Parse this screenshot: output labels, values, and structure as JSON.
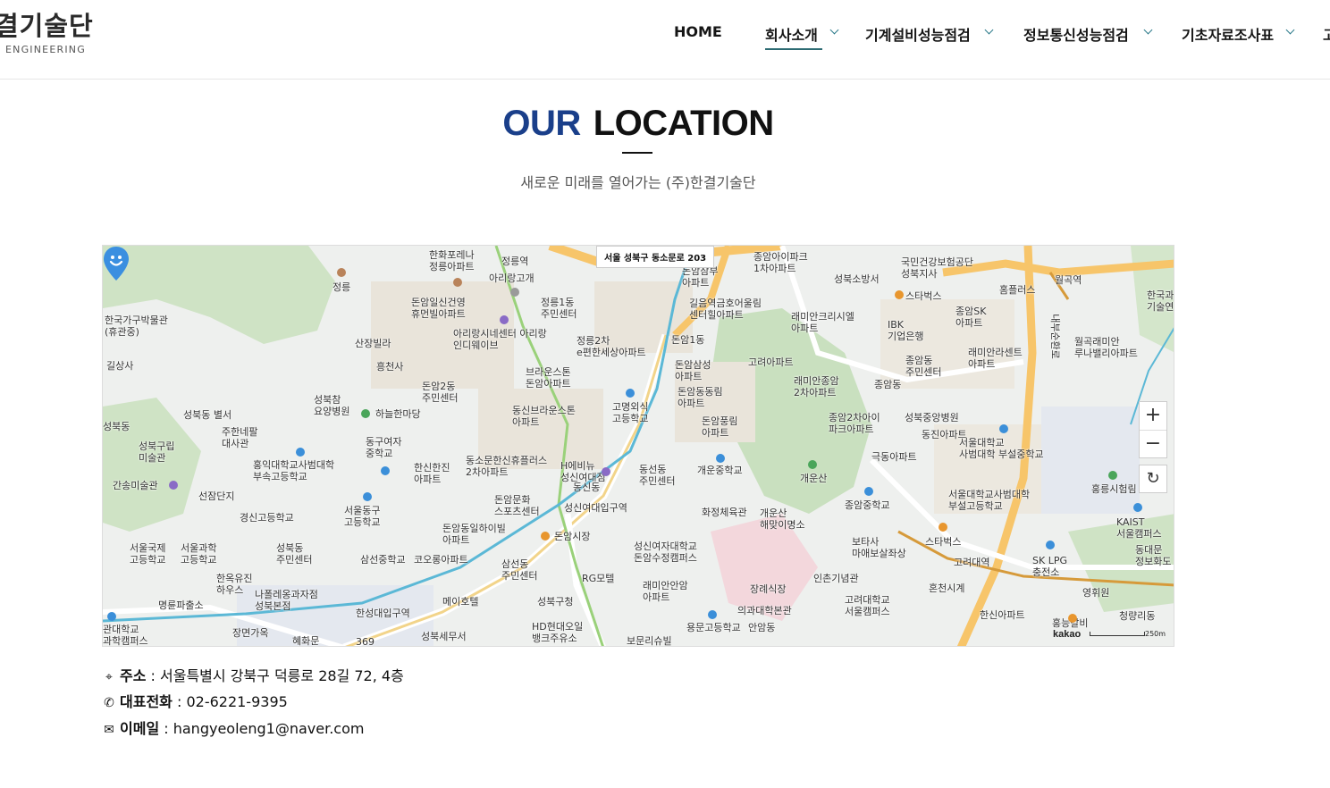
{
  "header": {
    "logo_text": "결기술단",
    "logo_sub": "ENGINEERING",
    "nav": [
      {
        "label": "HOME",
        "has_dropdown": false
      },
      {
        "label": "회사소개",
        "has_dropdown": true,
        "active": true
      },
      {
        "label": "기계설비성능점검",
        "has_dropdown": true
      },
      {
        "label": "정보통신성능점검",
        "has_dropdown": true
      },
      {
        "label": "기초자료조사표",
        "has_dropdown": true
      },
      {
        "label": "고",
        "has_dropdown": false
      }
    ]
  },
  "section": {
    "title_accent": "OUR",
    "title_main": "LOCATION",
    "subtitle": "새로운 미래를 열어가는 (주)한결기술단"
  },
  "map": {
    "tooltip": "서울 성북구 동소문로 203",
    "zoom_in": "+",
    "zoom_out": "−",
    "reset": "↻",
    "brand": "kakao",
    "scale_label": "250m",
    "labels": {
      "l1": "한화포레나\n정릉아파트",
      "l2": "정릉역",
      "l3": "아리랑고개",
      "l4": "정릉",
      "l5": "돈암일신건영\n휴먼빌아파트",
      "l6": "정릉1동\n주민센터",
      "l7": "한국가구박물관\n(휴관중)",
      "l8": "아리랑시네센터 아리랑\n인디웨이브",
      "l9": "산장빌라",
      "l10": "정릉2차\ne편한세상아파트",
      "l11": "길상사",
      "l12": "흥천사",
      "l13": "돈암2동\n주민센터",
      "l14": "브라운스톤\n돈암아파트",
      "l15": "성북참\n요양병원",
      "l16": "하늘한마당",
      "l17": "동신브라운스톤\n아파트",
      "l18": "고명외식\n고등학교",
      "l19": "성북동 별서",
      "l20": "성북동",
      "l21": "주한네팔\n대사관",
      "l22": "성북구립\n미술관",
      "l23": "동구여자\n중학교",
      "l24": "홍익대학교사범대학\n부속고등학교",
      "l25": "한신한진\n아파트",
      "l26": "동소문한신휴플러스\n2차아파트",
      "l27": "간송미술관",
      "l28": "선잠단지",
      "l29": "H에비뉴\n성신여대점",
      "l30": "동신동",
      "l31": "동선동\n주민센터",
      "l32": "경신고등학교",
      "l33": "서울동구\n고등학교",
      "l34": "돈암문화\n스포츠센터",
      "l35": "성신여대입구역",
      "l36": "돈암동일하이빌\n아파트",
      "l37": "돈암시장",
      "l38": "서울국제\n고등학교",
      "l39": "서울과학\n고등학교",
      "l40": "성북동\n주민센터",
      "l41": "삼선중학교",
      "l42": "코오롱아파트",
      "l43": "삼선동\n주민센터",
      "l44": "RG모텔",
      "l45": "한옥유진\n하우스",
      "l46": "나폴레옹과자점\n성북본점",
      "l47": "명륜파출소",
      "l48": "메이호텔",
      "l49": "성북구청",
      "l50": "한성대입구역",
      "l51": "관대학교\n과학캠퍼스",
      "l52": "장면가옥",
      "l53": "혜화문",
      "l54": "성북세무서",
      "l55": "HD현대오일\n뱅크주유소",
      "l56": "보문리슈빌",
      "l57": "돈암삼부\n아파트",
      "l58": "길음역금호어울림\n센터힐아파트",
      "l59": "돈암1동",
      "l60": "돈암삼성\n아파트",
      "l61": "돈암동동림\n아파트",
      "l62": "돈암풍림\n아파트",
      "l63": "개운중학교",
      "l64": "종암아이파크\n1차아파트",
      "l65": "성북소방서",
      "l66": "래미안크리시엘\n아파트",
      "l67": "IBK\n기업은행",
      "l68": "고려아파트",
      "l69": "래미안종암\n2차아파트",
      "l70": "종암동",
      "l71": "종암2차아이\n파크아파트",
      "l72": "개운산",
      "l73": "화정체육관",
      "l74": "개운산\n해맞이명소",
      "l75": "래미안안암\n아파트",
      "l76": "성신여자대학교\n돈암수정캠퍼스",
      "l77": "장례식장",
      "l78": "의과대학본관",
      "l79": "용문고등학교",
      "l80": "안암동",
      "l81": "국민건강보험공단\n성북지사",
      "l82": "스타벅스",
      "l83": "종암SK\n아파트",
      "l84": "홈플러스",
      "l85": "월곡역",
      "l86": "래미안라센트\n아파트",
      "l87": "종암동\n주민센터",
      "l88": "성북중앙병원",
      "l89": "동진아파트",
      "l90": "극동아파트",
      "l91": "서울대학교\n사범대학 부설중학교",
      "l92": "종암중학교",
      "l93": "서울대학교사범대학\n부설고등학교",
      "l94": "보타사\n마애보살좌상",
      "l95": "스타벅스",
      "l96": "고려대역",
      "l97": "인촌기념관",
      "l98": "혼천시계",
      "l99": "고려대학교\n서울캠퍼스",
      "l100": "한신아파트",
      "l101": "한국과\n기술연",
      "l102": "월곡래미안\n루나밸리아파트",
      "l103": "홍릉시험림",
      "l104": "KAIST\n서울캠퍼스",
      "l105": "동대문\n정보화도",
      "l106": "SK LPG\n충전소",
      "l107": "영휘원",
      "l108": "청량리동",
      "l109": "홍능갈비",
      "l110": "내부순환로",
      "l111": "369"
    }
  },
  "contact": {
    "address_key": "주소",
    "address_value": " : 서울특별시 강북구 덕릉로 28길 72, 4층",
    "phone_key": "대표전화",
    "phone_value": " : 02-6221-9395",
    "email_key": "이메일",
    "email_value": " : hangyeoleng1@naver.com"
  },
  "colors": {
    "accent_title": "#1a3f8a",
    "nav_underline": "#2d6b73",
    "marker": "#3b8fe0"
  }
}
